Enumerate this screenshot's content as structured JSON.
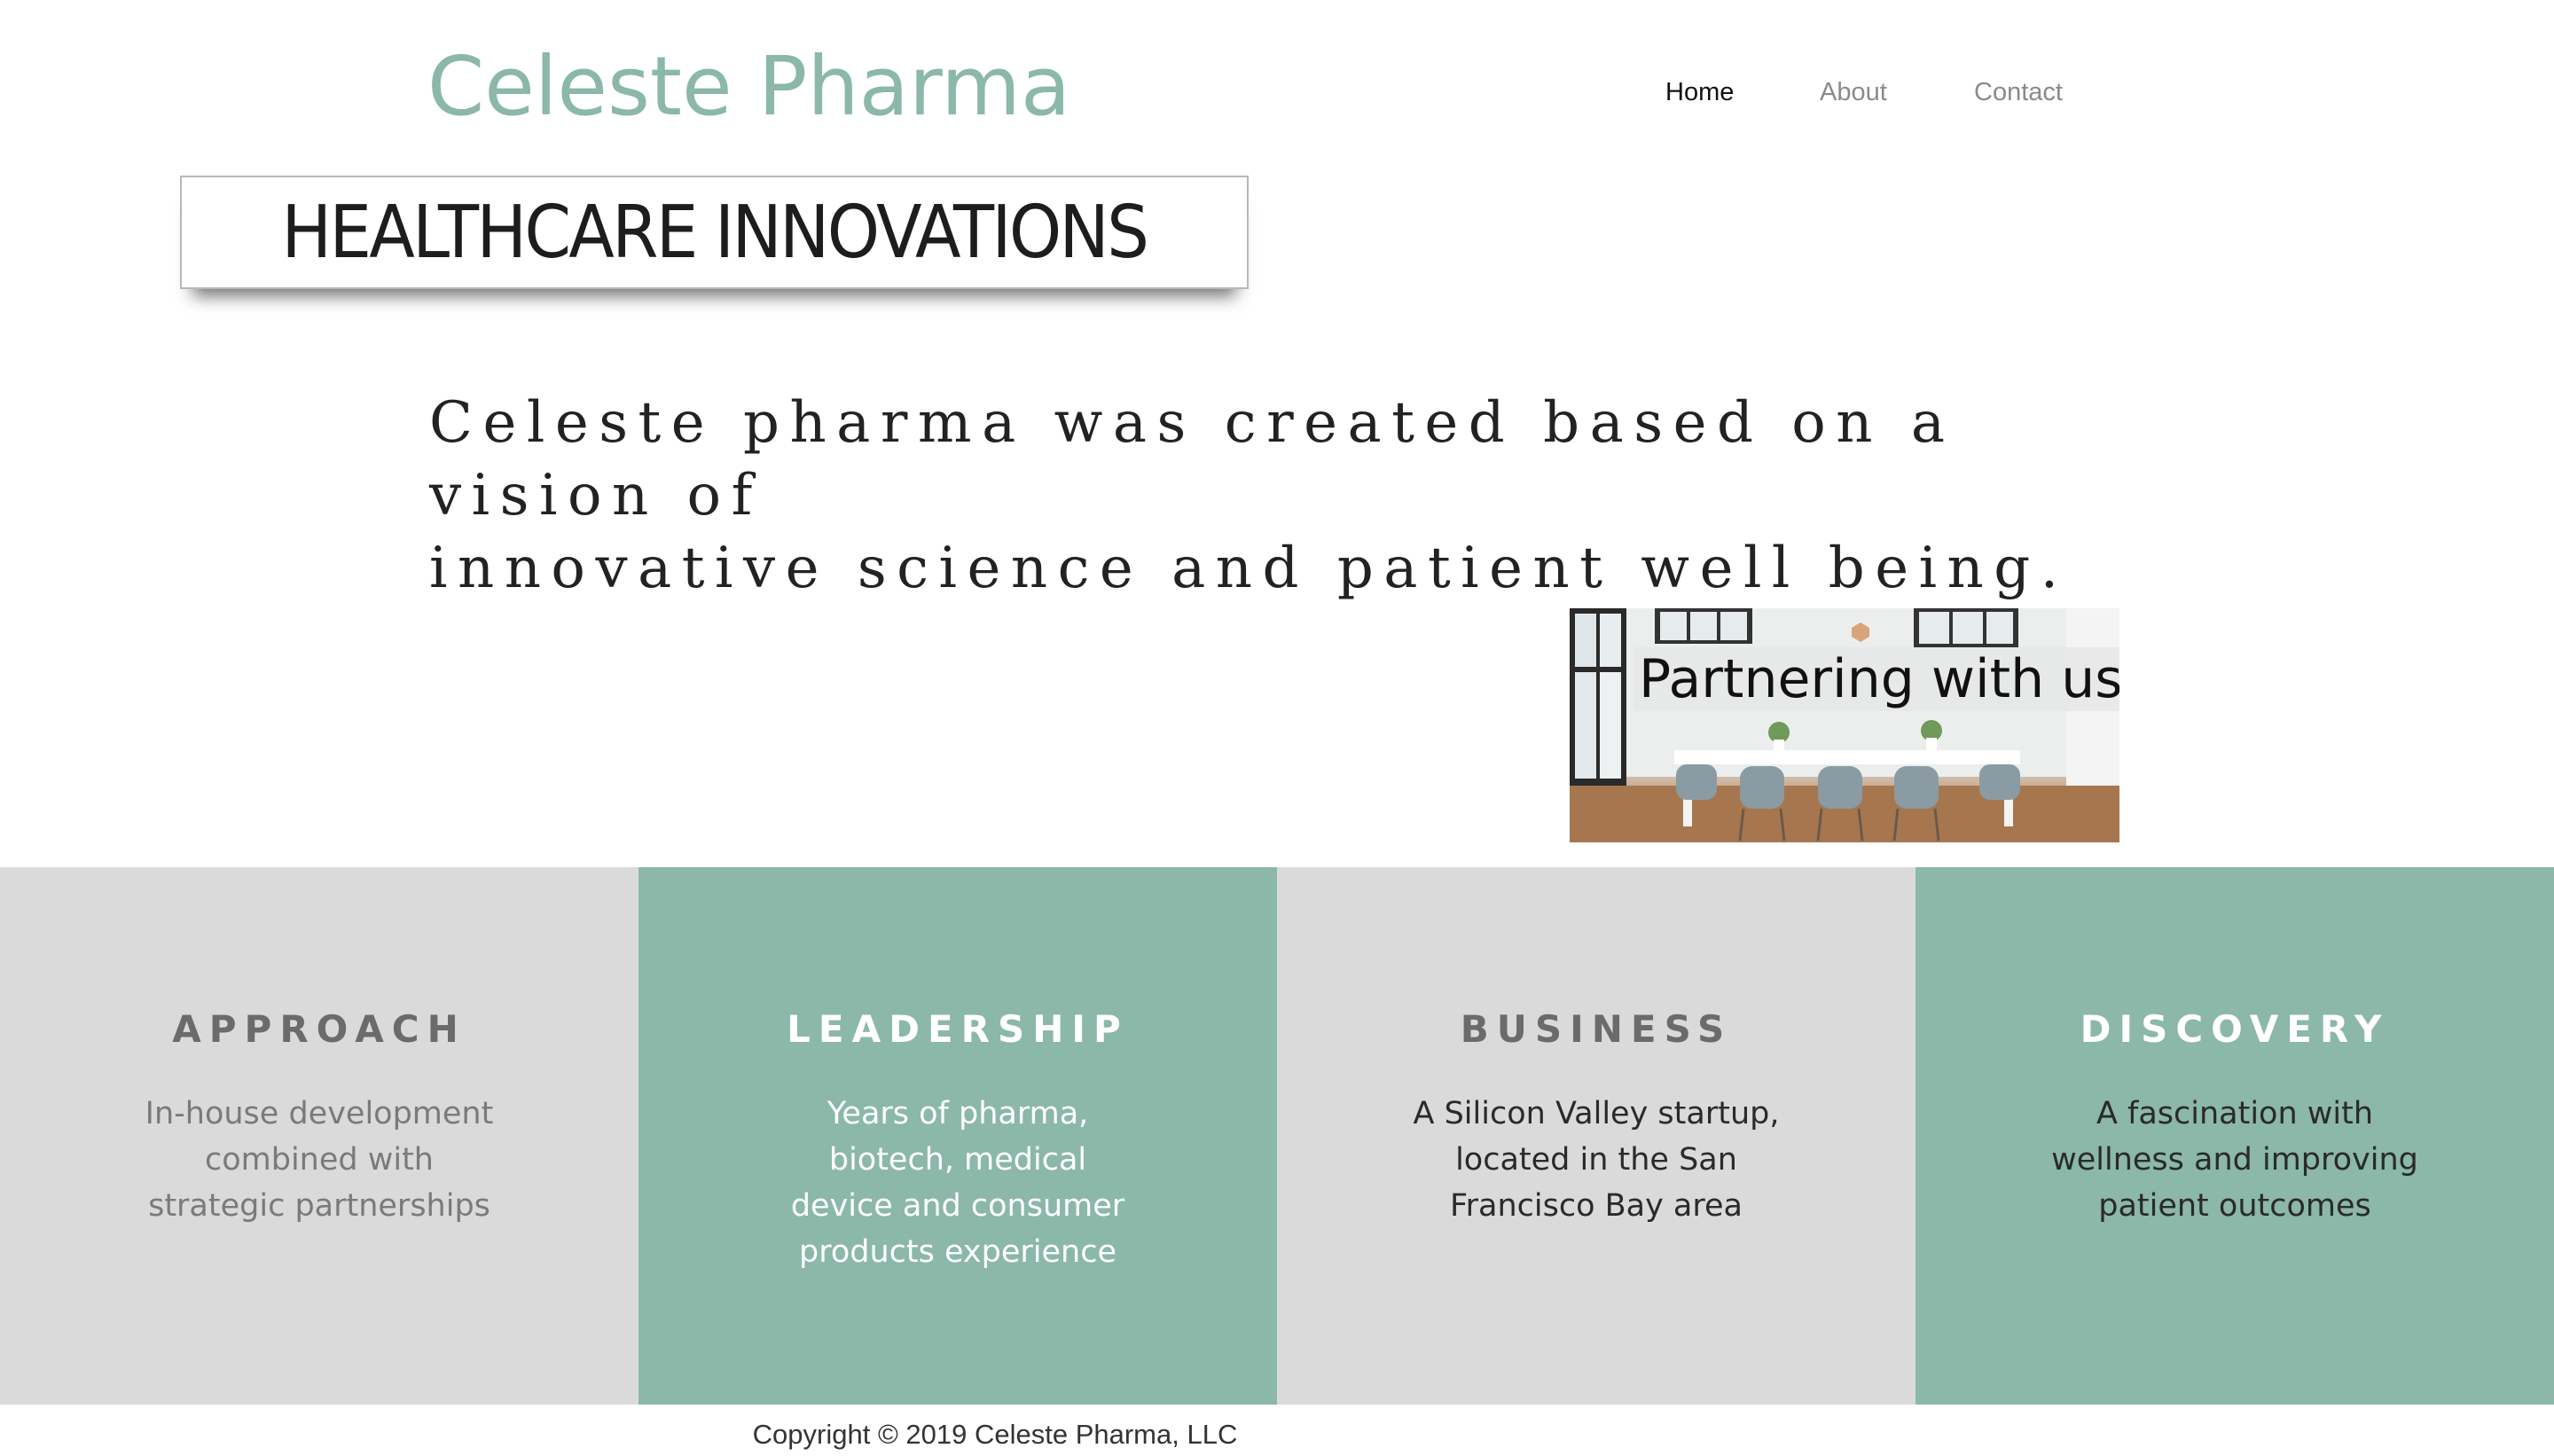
{
  "site": {
    "title": "Celeste Pharma",
    "brand_color": "#8bb8a8"
  },
  "nav": {
    "items": [
      {
        "label": "Home",
        "active": true
      },
      {
        "label": "About",
        "active": false
      },
      {
        "label": "Contact",
        "active": false
      }
    ]
  },
  "banner": {
    "text": "HEALTHCARE INNOVATIONS"
  },
  "tagline": {
    "line1": "Celeste pharma was created based on a vision of",
    "line2": "innovative science and patient well being."
  },
  "partner": {
    "label": "Partnering with us",
    "image_icon": "conference-room-photo"
  },
  "features": [
    {
      "heading": "APPROACH",
      "lines": [
        "In-house development",
        "combined with",
        "strategic partnerships"
      ],
      "color": "#dadada"
    },
    {
      "heading": "LEADERSHIP",
      "lines": [
        "Years of pharma,",
        "biotech, medical",
        "device and consumer",
        "products experience"
      ],
      "color": "#8bb8a8"
    },
    {
      "heading": "BUSINESS",
      "lines": [
        "A Silicon Valley startup,",
        "located in the San",
        "Francisco Bay area"
      ],
      "color": "#dadada"
    },
    {
      "heading": "DISCOVERY",
      "lines": [
        "A fascination with",
        "wellness and improving",
        "patient outcomes"
      ],
      "color": "#8bb8a8"
    }
  ],
  "footer": {
    "copyright": "Copyright © 2019 Celeste Pharma, LLC"
  }
}
